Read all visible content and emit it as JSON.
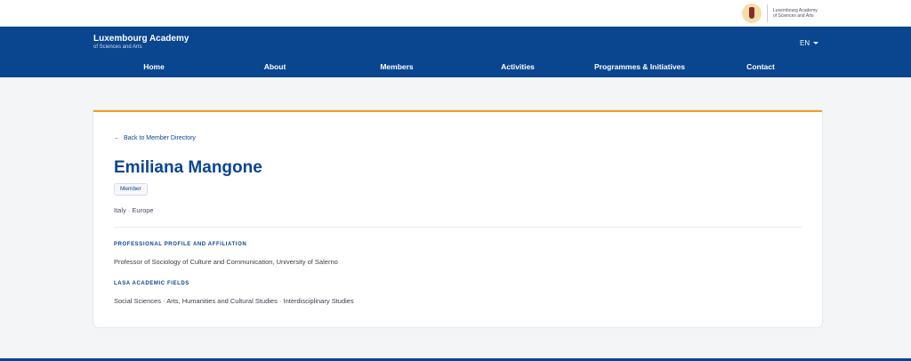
{
  "topbar": {
    "logo_text_line1": "Luxembourg Academy",
    "logo_text_line2": "of Sciences and Arts"
  },
  "header": {
    "brand_name": "Luxembourg Academy",
    "brand_sub": "of Sciences and Arts",
    "language": "EN",
    "nav": [
      {
        "label": "Home"
      },
      {
        "label": "About"
      },
      {
        "label": "Members"
      },
      {
        "label": "Activities"
      },
      {
        "label": "Programmes & Initiatives"
      },
      {
        "label": "Contact"
      }
    ]
  },
  "profile": {
    "back_link": "Back to Member Directory",
    "back_arrow": "←",
    "name": "Emiliana Mangone",
    "badge": "Member",
    "location": "Italy · Europe",
    "affiliation_heading": "PROFESSIONAL PROFILE AND AFFILIATION",
    "affiliation_text": "Professor of Sociology of Culture and Communication, University of Salerno",
    "fields_heading": "LASA ACADEMIC FIELDS",
    "fields_text": "Social Sciences · Arts, Humanities and Cultural Studies · Interdisciplinary Studies"
  },
  "colors": {
    "brand_blue": "#0a4590",
    "accent_orange": "#f0a020"
  }
}
